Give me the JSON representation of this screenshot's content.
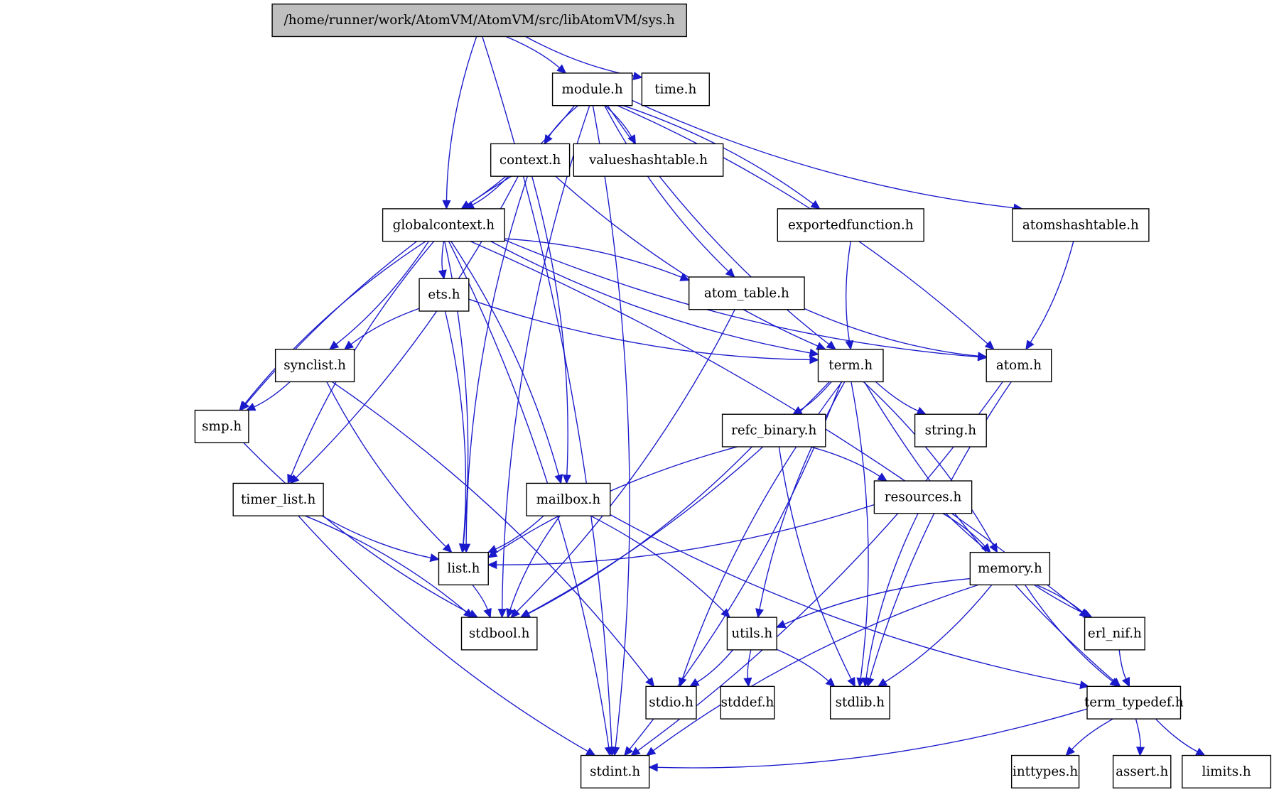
{
  "title": "/home/runner/work/AtomVM/AtomVM/src/libAtomVM/sys.h",
  "colors": {
    "edge": "#1a1acc",
    "root_fill": "#bfbfbf",
    "node_fill": "#ffffff",
    "node_border": "#000000"
  },
  "nodes": [
    {
      "id": "sys",
      "label": "/home/runner/work/AtomVM/AtomVM/src/libAtomVM/sys.h",
      "root": true
    },
    {
      "id": "module",
      "label": "module.h"
    },
    {
      "id": "time",
      "label": "time.h"
    },
    {
      "id": "context",
      "label": "context.h"
    },
    {
      "id": "valueshashtable",
      "label": "valueshashtable.h"
    },
    {
      "id": "globalcontext",
      "label": "globalcontext.h"
    },
    {
      "id": "exportedfunction",
      "label": "exportedfunction.h"
    },
    {
      "id": "atomshashtable",
      "label": "atomshashtable.h"
    },
    {
      "id": "ets",
      "label": "ets.h"
    },
    {
      "id": "atom_table",
      "label": "atom_table.h"
    },
    {
      "id": "synclist",
      "label": "synclist.h"
    },
    {
      "id": "term",
      "label": "term.h"
    },
    {
      "id": "atom",
      "label": "atom.h"
    },
    {
      "id": "smp",
      "label": "smp.h"
    },
    {
      "id": "refc_binary",
      "label": "refc_binary.h"
    },
    {
      "id": "string",
      "label": "string.h"
    },
    {
      "id": "timer_list",
      "label": "timer_list.h"
    },
    {
      "id": "mailbox",
      "label": "mailbox.h"
    },
    {
      "id": "resources",
      "label": "resources.h"
    },
    {
      "id": "list",
      "label": "list.h"
    },
    {
      "id": "memory",
      "label": "memory.h"
    },
    {
      "id": "stdbool",
      "label": "stdbool.h"
    },
    {
      "id": "utils",
      "label": "utils.h"
    },
    {
      "id": "erl_nif",
      "label": "erl_nif.h"
    },
    {
      "id": "stdio",
      "label": "stdio.h"
    },
    {
      "id": "stddef",
      "label": "stddef.h"
    },
    {
      "id": "stdlib",
      "label": "stdlib.h"
    },
    {
      "id": "term_typedef",
      "label": "term_typedef.h"
    },
    {
      "id": "stdint",
      "label": "stdint.h"
    },
    {
      "id": "inttypes",
      "label": "inttypes.h"
    },
    {
      "id": "assert",
      "label": "assert.h"
    },
    {
      "id": "limits",
      "label": "limits.h"
    }
  ],
  "edges": [
    [
      "sys",
      "stdint"
    ],
    [
      "sys",
      "globalcontext"
    ],
    [
      "sys",
      "module"
    ],
    [
      "sys",
      "time"
    ],
    [
      "module",
      "stdint"
    ],
    [
      "module",
      "stdbool"
    ],
    [
      "module",
      "globalcontext"
    ],
    [
      "module",
      "context"
    ],
    [
      "module",
      "valueshashtable"
    ],
    [
      "module",
      "atom_table"
    ],
    [
      "module",
      "exportedfunction"
    ],
    [
      "module",
      "term"
    ],
    [
      "module",
      "atom"
    ],
    [
      "module",
      "atomshashtable"
    ],
    [
      "context",
      "globalcontext"
    ],
    [
      "context",
      "smp"
    ],
    [
      "context",
      "timer_list"
    ],
    [
      "context",
      "list"
    ],
    [
      "context",
      "mailbox"
    ],
    [
      "context",
      "term"
    ],
    [
      "globalcontext",
      "stdint"
    ],
    [
      "globalcontext",
      "smp"
    ],
    [
      "globalcontext",
      "synclist"
    ],
    [
      "globalcontext",
      "timer_list"
    ],
    [
      "globalcontext",
      "list"
    ],
    [
      "globalcontext",
      "ets"
    ],
    [
      "globalcontext",
      "mailbox"
    ],
    [
      "globalcontext",
      "term"
    ],
    [
      "globalcontext",
      "atom_table"
    ],
    [
      "globalcontext",
      "atom"
    ],
    [
      "globalcontext",
      "erl_nif"
    ],
    [
      "exportedfunction",
      "term"
    ],
    [
      "atomshashtable",
      "atom"
    ],
    [
      "ets",
      "synclist"
    ],
    [
      "ets",
      "list"
    ],
    [
      "ets",
      "term"
    ],
    [
      "atom_table",
      "stdbool"
    ],
    [
      "atom_table",
      "atom"
    ],
    [
      "synclist",
      "smp"
    ],
    [
      "synclist",
      "list"
    ],
    [
      "synclist",
      "stdio"
    ],
    [
      "smp",
      "stdbool"
    ],
    [
      "term",
      "stdbool"
    ],
    [
      "term",
      "stdio"
    ],
    [
      "term",
      "refc_binary"
    ],
    [
      "term",
      "utils"
    ],
    [
      "term",
      "stdlib"
    ],
    [
      "term",
      "string"
    ],
    [
      "term",
      "memory"
    ],
    [
      "term",
      "term_typedef"
    ],
    [
      "term",
      "stdint"
    ],
    [
      "atom",
      "stdlib"
    ],
    [
      "atom",
      "stdint"
    ],
    [
      "refc_binary",
      "list"
    ],
    [
      "refc_binary",
      "stdbool"
    ],
    [
      "refc_binary",
      "stdlib"
    ],
    [
      "refc_binary",
      "resources"
    ],
    [
      "timer_list",
      "list"
    ],
    [
      "timer_list",
      "stdbool"
    ],
    [
      "timer_list",
      "stdint"
    ],
    [
      "mailbox",
      "list"
    ],
    [
      "mailbox",
      "stdbool"
    ],
    [
      "mailbox",
      "utils"
    ],
    [
      "mailbox",
      "term_typedef"
    ],
    [
      "resources",
      "list"
    ],
    [
      "resources",
      "stdlib"
    ],
    [
      "resources",
      "memory"
    ],
    [
      "resources",
      "erl_nif"
    ],
    [
      "list",
      "stdbool"
    ],
    [
      "memory",
      "utils"
    ],
    [
      "memory",
      "stdlib"
    ],
    [
      "memory",
      "stdint"
    ],
    [
      "memory",
      "erl_nif"
    ],
    [
      "memory",
      "term_typedef"
    ],
    [
      "utils",
      "stdio"
    ],
    [
      "utils",
      "stddef"
    ],
    [
      "utils",
      "stdlib"
    ],
    [
      "erl_nif",
      "term_typedef"
    ],
    [
      "term_typedef",
      "stdint"
    ],
    [
      "term_typedef",
      "inttypes"
    ],
    [
      "term_typedef",
      "assert"
    ],
    [
      "term_typedef",
      "limits"
    ]
  ]
}
